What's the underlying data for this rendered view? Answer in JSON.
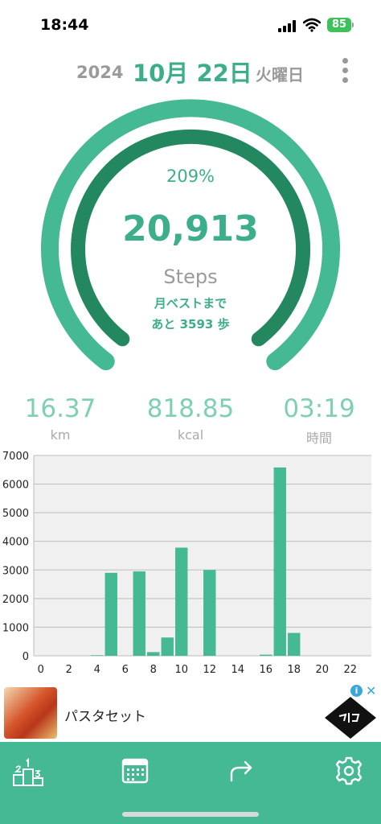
{
  "status_bar": {
    "time": "18:44",
    "battery": "85"
  },
  "date": {
    "year": "2024",
    "month_day": "10月 22日",
    "weekday": "火曜日"
  },
  "gauge": {
    "percent_text": "209%",
    "steps": "20,913",
    "label": "Steps",
    "best_line1": "月ベストまで",
    "best_line2": "あと 3593 歩",
    "percent_value": 209
  },
  "stats": [
    {
      "value": "16.37",
      "unit": "km"
    },
    {
      "value": "818.85",
      "unit": "kcal"
    },
    {
      "value": "03:19",
      "unit": "時間"
    }
  ],
  "chart_data": {
    "type": "bar",
    "title": "",
    "xlabel": "",
    "ylabel": "",
    "x": [
      0,
      1,
      2,
      3,
      4,
      5,
      6,
      7,
      8,
      9,
      10,
      11,
      12,
      13,
      14,
      15,
      16,
      17,
      18,
      19,
      20,
      21,
      22,
      23
    ],
    "values": [
      0,
      0,
      0,
      0,
      20,
      2900,
      0,
      2950,
      130,
      640,
      3780,
      0,
      3000,
      0,
      0,
      0,
      40,
      6580,
      800,
      0,
      0,
      0,
      0,
      0
    ],
    "xlim": [
      -0.5,
      23.5
    ],
    "ylim": [
      0,
      7000
    ],
    "xticks": [
      0,
      2,
      4,
      6,
      8,
      10,
      12,
      14,
      16,
      18,
      20,
      22
    ],
    "yticks": [
      0,
      1000,
      2000,
      3000,
      4000,
      5000,
      6000,
      7000
    ],
    "grid": true,
    "color": "#45b894",
    "plot_background": "#f0f0f0"
  },
  "ad": {
    "title": "パスタセット",
    "info_icon": "i",
    "close_icon": "✕"
  },
  "colors": {
    "accent": "#3dae8b",
    "ring_outer": "#45b894",
    "ring_inner": "#23885f",
    "tabbar": "#45b894"
  },
  "tabbar": {
    "icons": [
      "ranking-icon",
      "calendar-icon",
      "share-icon",
      "gear-icon"
    ]
  }
}
